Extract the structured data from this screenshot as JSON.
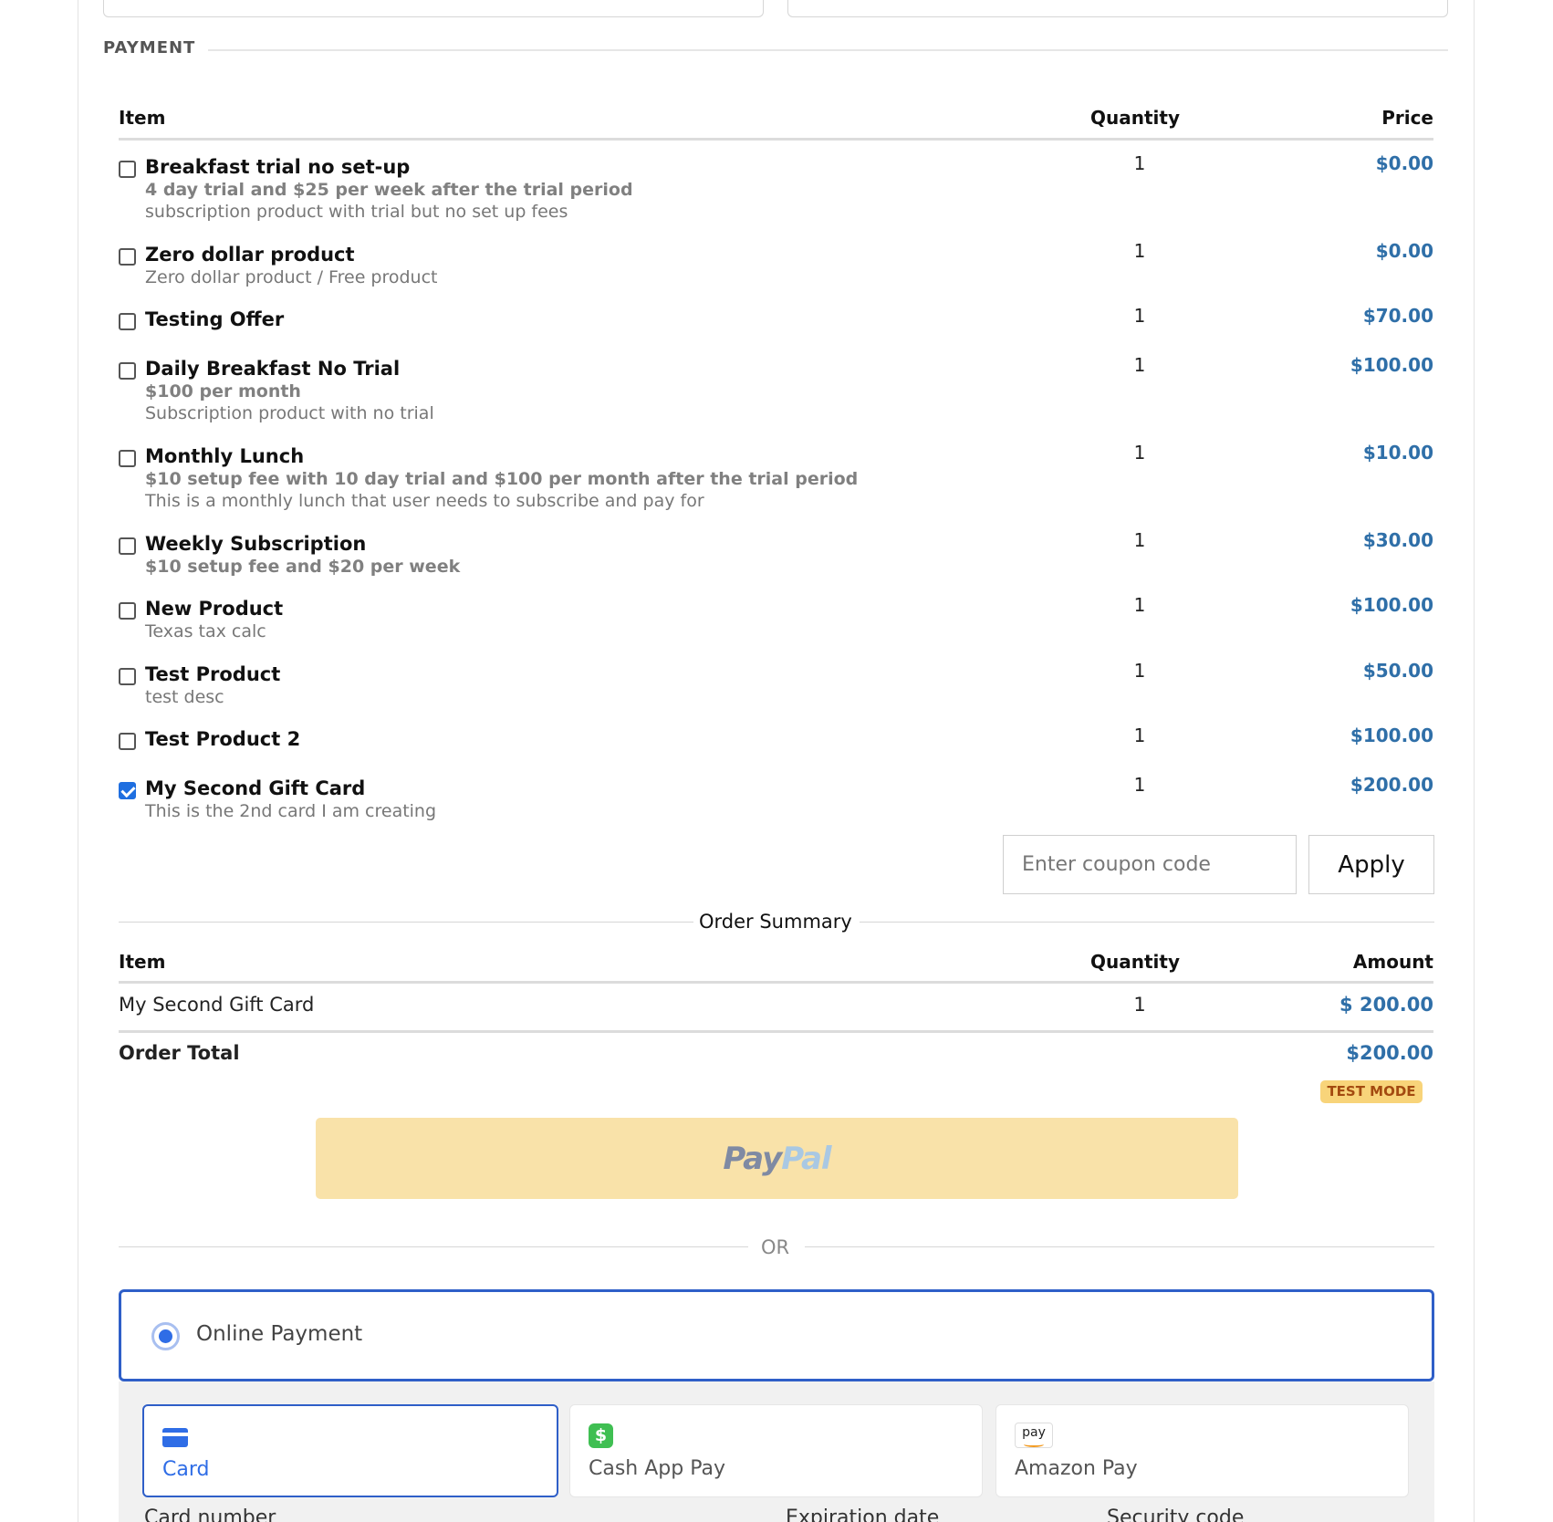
{
  "payment": {
    "section_title": "PAYMENT",
    "items_table": {
      "headers": {
        "item": "Item",
        "quantity": "Quantity",
        "price": "Price"
      },
      "rows": [
        {
          "name": "Breakfast trial no set-up",
          "bold_line": "4 day trial and $25 per week after the trial period",
          "description": "subscription product with trial but no set up fees",
          "quantity": "1",
          "price": "$0.00",
          "checked": false
        },
        {
          "name": "Zero dollar product",
          "bold_line": "",
          "description": "Zero dollar product / Free product",
          "quantity": "1",
          "price": "$0.00",
          "checked": false
        },
        {
          "name": "Testing Offer",
          "bold_line": "",
          "description": "",
          "quantity": "1",
          "price": "$70.00",
          "checked": false
        },
        {
          "name": "Daily Breakfast No Trial",
          "bold_line": "$100 per month",
          "description": "Subscription product with no trial",
          "quantity": "1",
          "price": "$100.00",
          "checked": false
        },
        {
          "name": "Monthly Lunch",
          "bold_line": "$10 setup fee with 10 day trial and $100 per month after the trial period",
          "description": "This is a monthly lunch that user needs to subscribe and pay for",
          "quantity": "1",
          "price": "$10.00",
          "checked": false
        },
        {
          "name": "Weekly Subscription",
          "bold_line": "$10 setup fee and $20 per week",
          "description": "",
          "quantity": "1",
          "price": "$30.00",
          "checked": false
        },
        {
          "name": "New Product",
          "bold_line": "",
          "description": "Texas tax calc",
          "quantity": "1",
          "price": "$100.00",
          "checked": false
        },
        {
          "name": "Test Product",
          "bold_line": "",
          "description": "test desc",
          "quantity": "1",
          "price": "$50.00",
          "checked": false
        },
        {
          "name": "Test Product 2",
          "bold_line": "",
          "description": "",
          "quantity": "1",
          "price": "$100.00",
          "checked": false
        },
        {
          "name": "My Second Gift Card",
          "bold_line": "",
          "description": "This is the 2nd card I am creating",
          "quantity": "1",
          "price": "$200.00",
          "checked": true
        }
      ]
    },
    "coupon": {
      "placeholder": "Enter coupon code",
      "value": "",
      "apply_label": "Apply"
    },
    "order_summary": {
      "title": "Order Summary",
      "headers": {
        "item": "Item",
        "quantity": "Quantity",
        "amount": "Amount"
      },
      "rows": [
        {
          "item": "My Second Gift Card",
          "quantity": "1",
          "amount": "$ 200.00"
        }
      ],
      "total_label": "Order Total",
      "total_amount": "$200.00"
    },
    "test_mode_badge": "TEST MODE",
    "paypal": {
      "logo_part1": "Pay",
      "logo_part2": "Pal"
    },
    "or_label": "OR",
    "online_payment": {
      "label": "Online Payment",
      "selected": true
    },
    "methods": [
      {
        "label": "Card",
        "icon": "credit-card-icon",
        "active": true
      },
      {
        "label": "Cash App Pay",
        "icon": "cash-app-icon",
        "active": false
      },
      {
        "label": "Amazon Pay",
        "icon": "amazon-pay-icon",
        "active": false,
        "icon_text": "pay"
      }
    ],
    "card_fields": {
      "number_label": "Card number",
      "expiry_label": "Expiration date",
      "cvc_label": "Security code"
    }
  },
  "colors": {
    "price_blue": "#2f6fa8",
    "accent_blue": "#2f5fc8",
    "paypal_bg": "#f9e2a9",
    "test_mode_bg": "#f8d47a"
  }
}
